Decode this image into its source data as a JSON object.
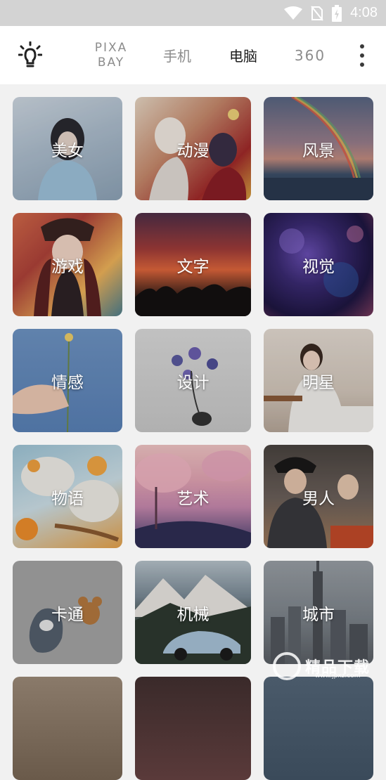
{
  "status_bar": {
    "time": "4:08",
    "icons": [
      "wifi-icon",
      "no-sim-icon",
      "battery-charging-icon"
    ]
  },
  "toolbar": {
    "icon": "lightbulb-icon",
    "tabs": [
      {
        "label": "PIXA\nBAY",
        "active": false
      },
      {
        "label": "手机",
        "active": false
      },
      {
        "label": "电脑",
        "active": true
      },
      {
        "label": "360",
        "active": false
      }
    ],
    "menu_icon": "more-vert-icon"
  },
  "categories": [
    {
      "label": "美女"
    },
    {
      "label": "动漫"
    },
    {
      "label": "风景"
    },
    {
      "label": "游戏"
    },
    {
      "label": "文字"
    },
    {
      "label": "视觉"
    },
    {
      "label": "情感"
    },
    {
      "label": "设计"
    },
    {
      "label": "明星"
    },
    {
      "label": "物语"
    },
    {
      "label": "艺术"
    },
    {
      "label": "男人"
    },
    {
      "label": "卡通"
    },
    {
      "label": "机械"
    },
    {
      "label": "城市"
    }
  ],
  "watermark": {
    "text": "精品下载",
    "subtext": "www.jpxz.com"
  },
  "colors": {
    "status_bar_bg": "#d3d3d3",
    "toolbar_bg": "#ffffff",
    "active_tab": "#1c1c1c",
    "inactive_tab": "#8c8c8c",
    "page_bg": "#f1f1f1"
  }
}
